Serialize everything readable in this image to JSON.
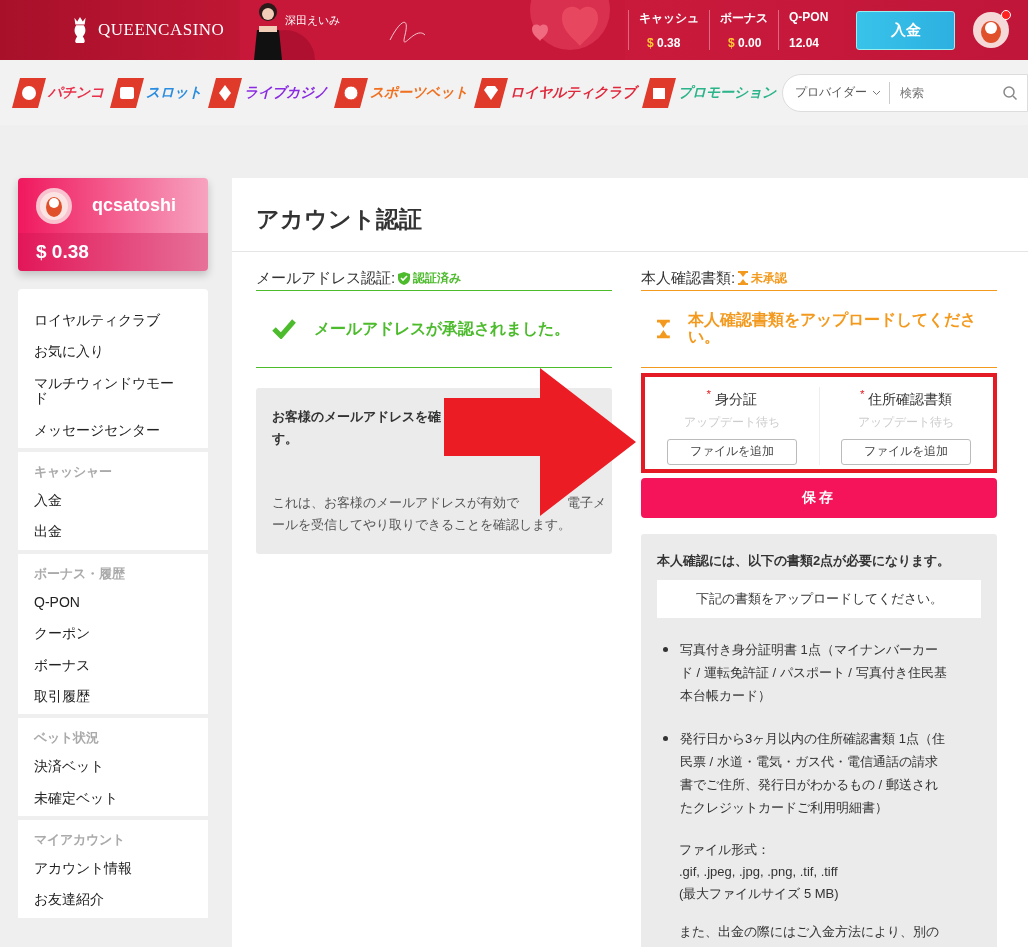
{
  "header": {
    "logo": "QUEENCASINO",
    "promo_name": "深田えいみ",
    "balances": [
      {
        "label": "キャッシュ",
        "currency": "$",
        "amount": "0.38"
      },
      {
        "label": "ボーナス",
        "currency": "$",
        "amount": "0.00"
      },
      {
        "label": "Q-PON",
        "amount": "12.04"
      }
    ],
    "deposit_button": "入金",
    "has_notification": true
  },
  "nav": {
    "items": [
      {
        "label": "パチンコ",
        "color": "#e8304a",
        "kind": "ball"
      },
      {
        "label": "スロット",
        "color": "#2a8de0",
        "kind": "slot"
      },
      {
        "label": "ライブカジノ",
        "color": "#8a2be2",
        "kind": "cards"
      },
      {
        "label": "スポーツベット",
        "color": "#f07020",
        "kind": "soccer"
      },
      {
        "label": "ロイヤルティクラブ",
        "color": "#e0283c",
        "kind": "diamond"
      },
      {
        "label": "プロモーション",
        "color": "#2bb38a",
        "kind": "gift"
      }
    ]
  },
  "search": {
    "provider": "プロバイダー",
    "placeholder": "検索"
  },
  "profile": {
    "username": "qcsatoshi",
    "balance": "$ 0.38"
  },
  "sidebar": {
    "sections": [
      {
        "items": [
          "ロイヤルティクラブ",
          "お気に入り",
          "マルチウィンドウモード",
          "メッセージセンター"
        ]
      },
      {
        "heading": "キャッシャー",
        "items": [
          "入金",
          "出金"
        ]
      },
      {
        "heading": "ボーナス・履歴",
        "items": [
          "Q-PON",
          "クーポン",
          "ボーナス",
          "取引履歴"
        ]
      },
      {
        "heading": "ベット状況",
        "items": [
          "決済ベット",
          "未確定ベット"
        ]
      },
      {
        "heading": "マイアカウント",
        "items": [
          "アカウント情報",
          "お友達紹介"
        ]
      }
    ]
  },
  "main": {
    "title": "アカウント認証",
    "verifications": [
      {
        "label": "メールアドレス認証:",
        "status": "認証済み",
        "verified": true,
        "message": "メールアドレスが承認されました。"
      },
      {
        "label": "本人確認書類:",
        "status": "未承認",
        "verified": false,
        "message": "本人確認書類をアップロードしてください。"
      }
    ],
    "email_info": {
      "line_1": "お客様のメールアドレスを確",
      "line_2": "す。",
      "paragraph_start": "これは、お客様のメールアドレスが有効で",
      "paragraph_middle": "電子メ",
      "paragraph_end": "ールを受信してやり取りできることを確認します。"
    },
    "uploads": [
      {
        "required_mark": "*",
        "label": "身分証",
        "status": "アップデート待ち",
        "button": "ファイルを追加"
      },
      {
        "required_mark": "*",
        "label": "住所確認書類",
        "status": "アップデート待ち",
        "button": "ファイルを追加"
      }
    ],
    "save_button": "保存",
    "requirements": {
      "title": "本人確認には、以下の書類2点が必要になります。",
      "note": "下記の書類をアップロードしてください。",
      "items": [
        "写真付き身分証明書 1点（マイナンバーカード / 運転免許証 / パスポート / 写真付き住民基本台帳カード）",
        "発行日から3ヶ月以内の住所確認書類 1点（住民票 / 水道・電気・ガス代・電信通話の請求書でご住所、発行日がわかるもの / 郵送されたクレジットカードご利用明細書）"
      ],
      "formats_label": "ファイル形式：",
      "formats": ".gif, .jpeg, .jpg, .png, .tif, .tiff",
      "max_size": "(最大ファイルサイズ 5 MB)",
      "footer": "また、出金の際にはご入金方法により、別の"
    }
  }
}
